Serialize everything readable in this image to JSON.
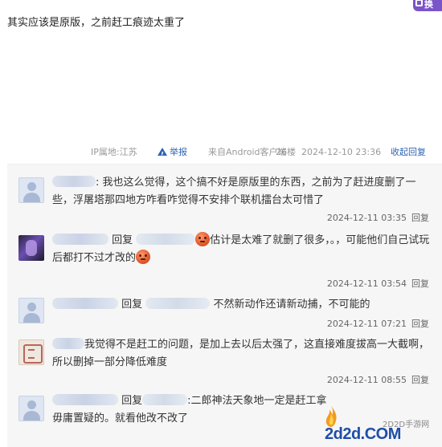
{
  "corner_badge": {
    "label": "换"
  },
  "post": {
    "text": "其实应该是原版，之前赶工痕迹太重了",
    "meta": {
      "ip": "IP属地:江苏",
      "report": "举报",
      "client": "来自Android客户端",
      "floor": "26楼",
      "time": "2024-12-10 23:36",
      "collapse": "收起回复"
    }
  },
  "replies": [
    {
      "avatar": "default-avatar",
      "user_visible": ":",
      "text": "我也这么觉得，这个搞不好是原版里的东西，之前为了赶进度删了一些，浮屠塔那四地方咋看咋觉得不安排个联机擂台太可惜了",
      "time": "2024-12-11 03:35",
      "reply_label": "回复"
    },
    {
      "avatar": "dark-character-avatar",
      "prefix": "回复",
      "text_a": "估计是太难了就删了很多，。，可能他们自己试玩后都打不过才改的",
      "time": "2024-12-11 03:54",
      "reply_label": "回复"
    },
    {
      "avatar": "default-avatar",
      "prefix": "回复",
      "text": "不然新动作还请新动捕，不可能的",
      "time": "2024-12-11 07:21",
      "reply_label": "回复"
    },
    {
      "avatar": "seal-avatar",
      "text": "我觉得不是赶工的问题，是加上去以后太强了，这直接难度拔高一大截啊，所以删掉一部分降低难度",
      "time": "2024-12-11 08:55",
      "reply_label": "回复"
    },
    {
      "avatar": "default-avatar",
      "prefix": "回复",
      "text_line1": ":二郎神法天象地一定是赶工拿",
      "text_line2": "毋庸置疑的。就看他改不改了"
    }
  ],
  "watermark": {
    "site": "2D2D手游网",
    "logo": "2d2d.COM"
  },
  "colors": {
    "link": "#2d64b3",
    "reply_bg": "#f6f6f6",
    "avatar_default": "#dfe6f3"
  }
}
